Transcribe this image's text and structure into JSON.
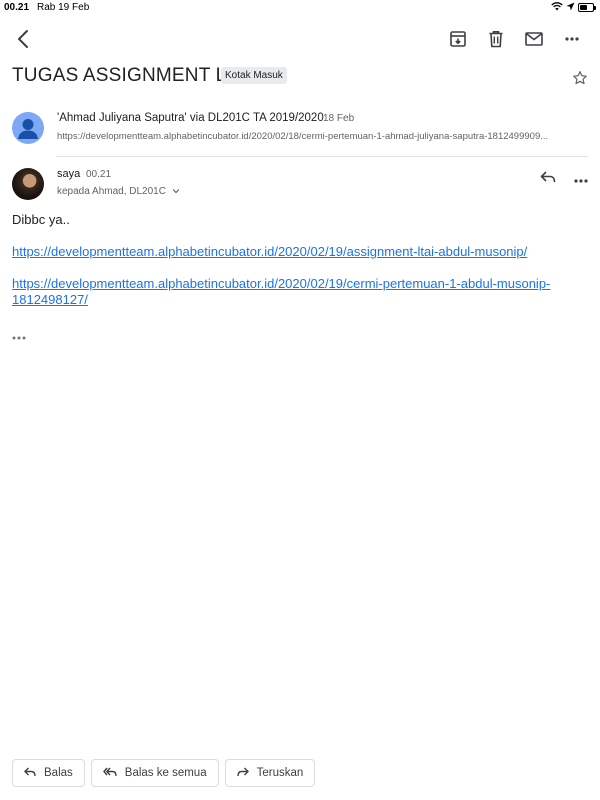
{
  "status_bar": {
    "time": "00.21",
    "date": "Rab 19 Feb",
    "battery_level": 0.55
  },
  "toolbar": {
    "back_icon": "chevron-left-icon",
    "archive_icon": "archive-icon",
    "delete_icon": "trash-icon",
    "mark_unread_icon": "mail-icon",
    "more_icon": "more-horizontal-icon"
  },
  "thread": {
    "subject": "TUGAS ASSIGNMENT LTAI",
    "label": "Kotak Masuk"
  },
  "collapsed_message": {
    "sender": "'Ahmad Juliyana Saputra' via DL201C TA 2019/2020",
    "date": "18 Feb",
    "snippet": "https://developmentteam.alphabetincubator.id/2020/02/18/cermi-pertemuan-1-ahmad-juliyana-saputra-1812499909..."
  },
  "open_message": {
    "sender": "saya",
    "time": "00.21",
    "recipients": "kepada Ahmad, DL201C",
    "body": "Dibbc ya..",
    "links": [
      "https://developmentteam.alphabetincubator.id/2020/02/19/assignment-ltai-abdul-musonip/",
      "https://developmentteam.alphabetincubator.id/2020/02/19/cermi-pertemuan-1-abdul-musonip-1812498127/"
    ]
  },
  "actions": {
    "reply": "Balas",
    "reply_all": "Balas ke semua",
    "forward": "Teruskan"
  },
  "colors": {
    "link": "#1a73e8",
    "chip_bg": "#e8eaed",
    "text_secondary": "#5f6368"
  }
}
